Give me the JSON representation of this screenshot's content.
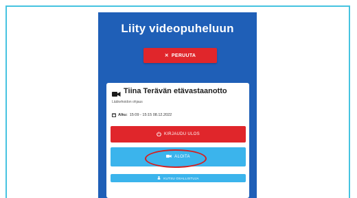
{
  "dialog": {
    "title": "Liity videopuheluun",
    "cancel_label": "PERUUTA"
  },
  "appointment": {
    "title": "Tiina Terävän etävastaanotto",
    "subtitle": "Lääkehoidon ohjaus",
    "time_label": "Alku:",
    "time_value": "15:09 - 15:15 08.12.2022"
  },
  "actions": {
    "logout_label": "KIRJAUDU ULOS",
    "start_label": "ALOITA",
    "invite_label": "KUTSU OSALLISTUJA"
  },
  "colors": {
    "header_blue": "#1f5fb7",
    "danger_red": "#e0262b",
    "action_blue": "#3bb4ec",
    "highlight_red": "#d42020",
    "frame_cyan": "#45c3e0"
  },
  "icons": {
    "cancel": "close-icon",
    "appointment": "video-camera-icon",
    "time": "calendar-icon",
    "logout": "power-icon",
    "start": "video-camera-icon",
    "invite": "person-add-icon"
  }
}
